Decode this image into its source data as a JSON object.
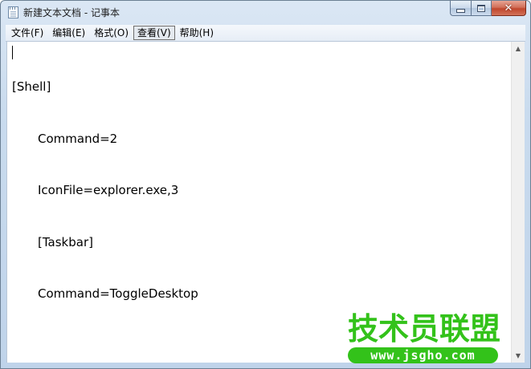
{
  "window": {
    "title": "新建文本文档 - 记事本",
    "close_glyph": "✕",
    "icons": {
      "app": "notepad-icon",
      "minimize": "minimize-icon",
      "maximize": "maximize-icon",
      "close": "close-icon"
    },
    "colors": {
      "frame": "#bfd3ea",
      "close_button": "#c1462c",
      "watermark": "#33c21a"
    }
  },
  "menu": {
    "file": "文件(F)",
    "edit": "编辑(E)",
    "format": "格式(O)",
    "view": "查看(V)",
    "help": "帮助(H)"
  },
  "editor": {
    "lines": [
      "[Shell]",
      "Command=2",
      "IconFile=explorer.exe,3",
      "[Taskbar]",
      "Command=ToggleDesktop"
    ]
  },
  "scrollbar": {
    "up": "▲",
    "down": "▼"
  },
  "watermark": {
    "title": "技术员联盟",
    "url": "www.jsgho.com"
  }
}
